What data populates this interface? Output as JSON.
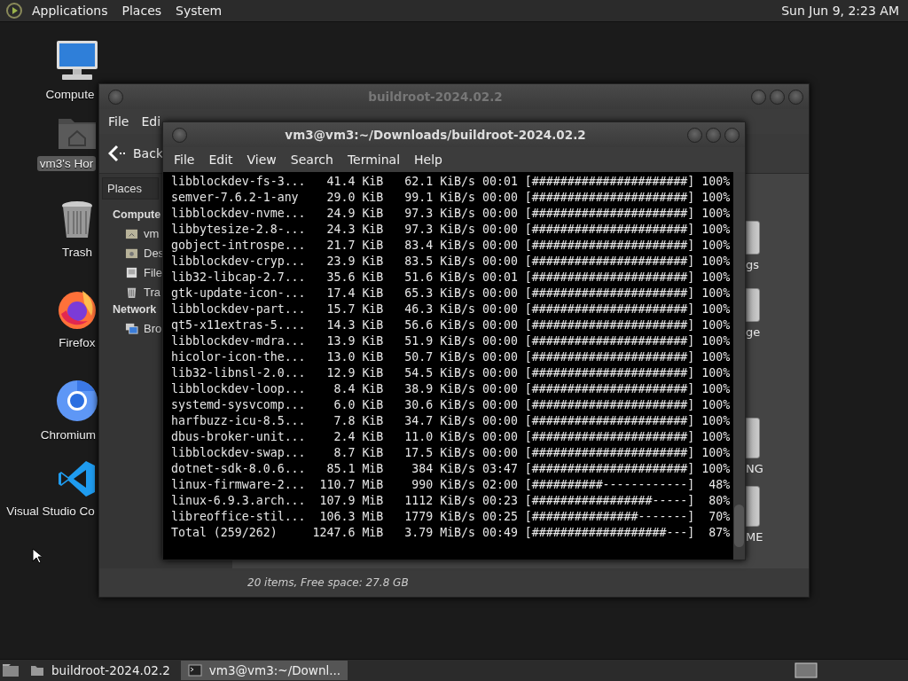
{
  "top_panel": {
    "menus": [
      "Applications",
      "Places",
      "System"
    ],
    "clock": "Sun Jun 9, 2:23 AM"
  },
  "desktop_icons": [
    {
      "label": "Compute",
      "kind": "computer",
      "selected": false
    },
    {
      "label": "vm3's Hor",
      "kind": "home",
      "selected": true
    },
    {
      "label": "Trash",
      "kind": "trash",
      "selected": false
    },
    {
      "label": "Firefox",
      "kind": "firefox",
      "selected": false
    },
    {
      "label": "Chromium",
      "kind": "chromium",
      "selected": false
    },
    {
      "label": "Visual Studio Co",
      "kind": "vscode",
      "selected": false
    }
  ],
  "file_manager": {
    "title": "buildroot-2024.02.2",
    "menu": [
      "File",
      "Edi"
    ],
    "back": "Back",
    "sidebar": {
      "header": "Places",
      "sections": [
        {
          "heading": "Compute",
          "items": [
            {
              "label": "vm",
              "kind": "home"
            },
            {
              "label": "Des",
              "kind": "desktop"
            },
            {
              "label": "File",
              "kind": "drive"
            },
            {
              "label": "Tra",
              "kind": "trash"
            }
          ]
        },
        {
          "heading": "Network",
          "items": [
            {
              "label": "Bro",
              "kind": "network"
            }
          ]
        }
      ]
    },
    "items": [
      {
        "label": "gs",
        "kind": "folder"
      },
      {
        "label": "ge",
        "kind": "folder"
      },
      {
        "label": "NG",
        "kind": "file"
      },
      {
        "label": "ME",
        "kind": "file"
      }
    ],
    "status": "20 items, Free space: 27.8 GB"
  },
  "terminal": {
    "title": "vm3@vm3:~/Downloads/buildroot-2024.02.2",
    "menu": [
      "File",
      "Edit",
      "View",
      "Search",
      "Terminal",
      "Help"
    ],
    "lines": [
      "libblockdev-fs-3...   41.4 KiB   62.1 KiB/s 00:01 [######################] 100%",
      "semver-7.6.2-1-any    29.0 KiB   99.1 KiB/s 00:00 [######################] 100%",
      "libblockdev-nvme...   24.9 KiB   97.3 KiB/s 00:00 [######################] 100%",
      "libbytesize-2.8-...   24.3 KiB   97.3 KiB/s 00:00 [######################] 100%",
      "gobject-introspe...   21.7 KiB   83.4 KiB/s 00:00 [######################] 100%",
      "libblockdev-cryp...   23.9 KiB   83.5 KiB/s 00:00 [######################] 100%",
      "lib32-libcap-2.7...   35.6 KiB   51.6 KiB/s 00:01 [######################] 100%",
      "gtk-update-icon-...   17.4 KiB   65.3 KiB/s 00:00 [######################] 100%",
      "libblockdev-part...   15.7 KiB   46.3 KiB/s 00:00 [######################] 100%",
      "qt5-x11extras-5....   14.3 KiB   56.6 KiB/s 00:00 [######################] 100%",
      "libblockdev-mdra...   13.9 KiB   51.9 KiB/s 00:00 [######################] 100%",
      "hicolor-icon-the...   13.0 KiB   50.7 KiB/s 00:00 [######################] 100%",
      "lib32-libnsl-2.0...   12.9 KiB   54.5 KiB/s 00:00 [######################] 100%",
      "libblockdev-loop...    8.4 KiB   38.9 KiB/s 00:00 [######################] 100%",
      "systemd-sysvcomp...    6.0 KiB   30.6 KiB/s 00:00 [######################] 100%",
      "harfbuzz-icu-8.5...    7.8 KiB   34.7 KiB/s 00:00 [######################] 100%",
      "dbus-broker-unit...    2.4 KiB   11.0 KiB/s 00:00 [######################] 100%",
      "libblockdev-swap...    8.7 KiB   17.5 KiB/s 00:00 [######################] 100%",
      "dotnet-sdk-8.0.6...   85.1 MiB    384 KiB/s 03:47 [######################] 100%",
      "linux-firmware-2...  110.7 MiB    990 KiB/s 02:00 [##########------------]  48%",
      "linux-6.9.3.arch...  107.9 MiB   1112 KiB/s 00:23 [#################-----]  80%",
      "libreoffice-stil...  106.3 MiB   1779 KiB/s 00:25 [###############-------]  70%",
      "Total (259/262)     1247.6 MiB   3.79 MiB/s 00:49 [###################---]  87%"
    ]
  },
  "taskbar": {
    "tasks": [
      {
        "label": "buildroot-2024.02.2",
        "kind": "folder",
        "selected": false
      },
      {
        "label": "vm3@vm3:~/Downl...",
        "kind": "terminal",
        "selected": true
      }
    ]
  }
}
